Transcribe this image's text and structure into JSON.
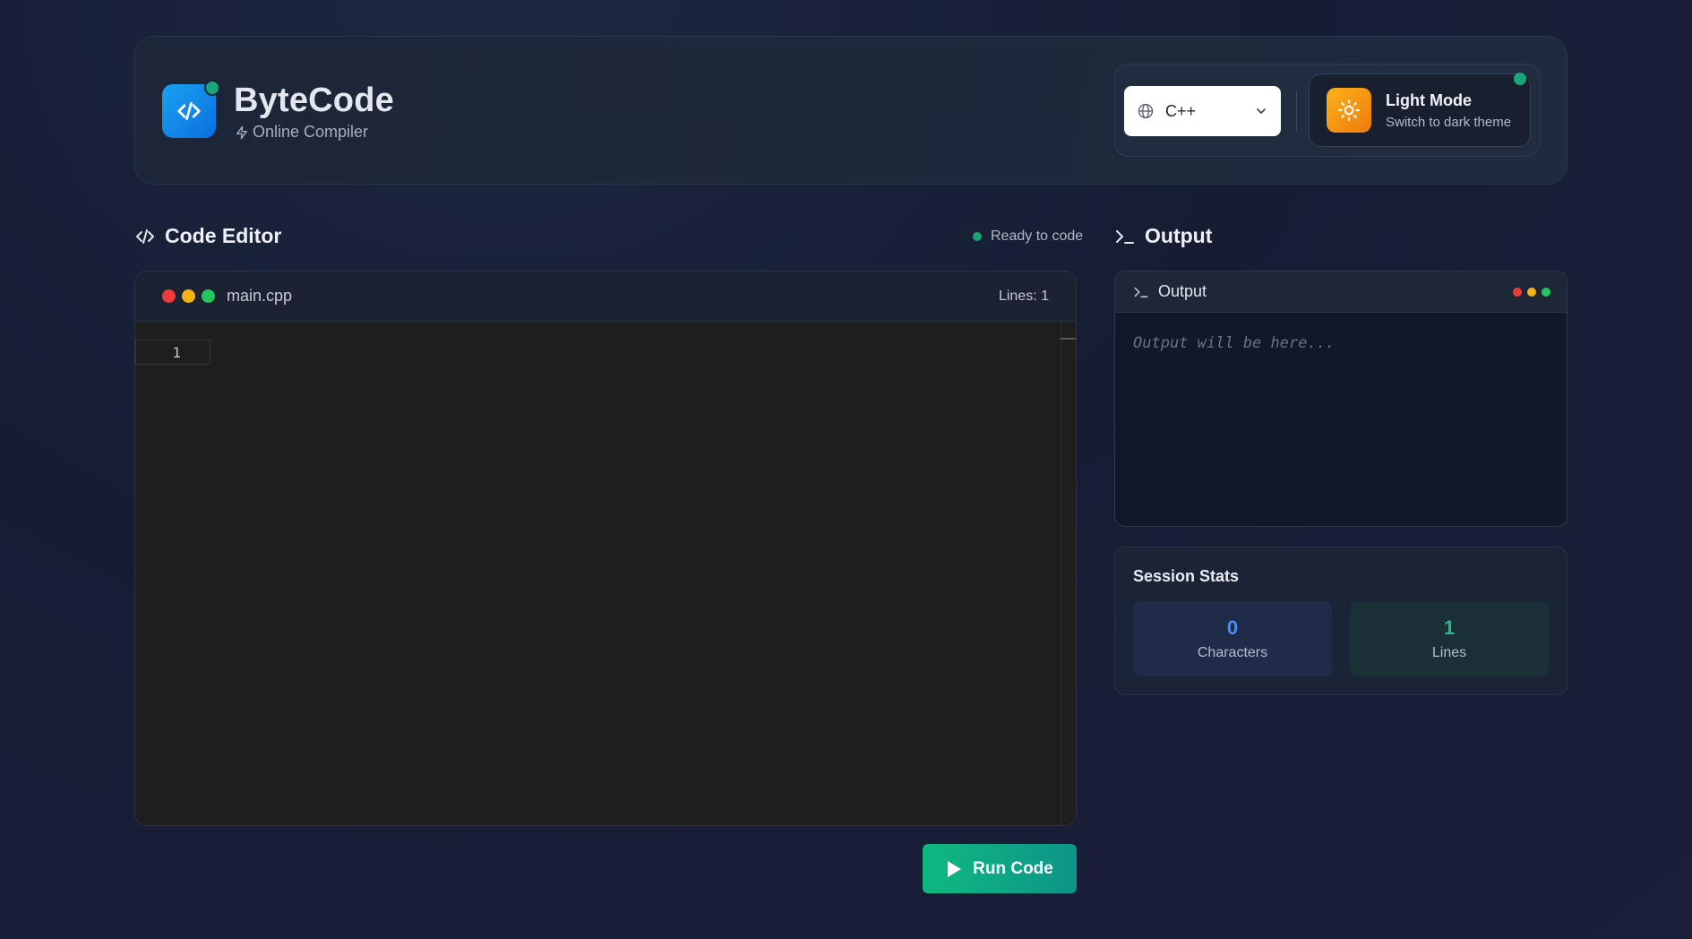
{
  "header": {
    "brand_title": "ByteCode",
    "brand_subtitle": "Online Compiler",
    "language": {
      "selected": "C++"
    },
    "theme_toggle": {
      "title": "Light Mode",
      "subtitle": "Switch to dark theme"
    }
  },
  "editor": {
    "section_title": "Code Editor",
    "status": "Ready to code",
    "filename": "main.cpp",
    "lines_label": "Lines: 1",
    "line_numbers": [
      "1"
    ]
  },
  "run_button": {
    "label": "Run Code"
  },
  "output": {
    "section_title": "Output",
    "panel_label": "Output",
    "placeholder": "Output will be here..."
  },
  "stats": {
    "title": "Session Stats",
    "characters": {
      "value": "0",
      "label": "Characters"
    },
    "lines": {
      "value": "1",
      "label": "Lines"
    }
  },
  "colors": {
    "accent_blue": "#0a6fe0",
    "accent_green": "#10b981",
    "accent_orange": "#f07a0c",
    "status_dot": "#16a672",
    "traffic_red": "#ef3b3b",
    "traffic_yellow": "#f3b317",
    "traffic_green": "#22c55e"
  },
  "icons": {
    "logo": "code-brackets-icon",
    "subtitle": "lightning-icon",
    "language": "globe-icon",
    "dropdown": "chevron-down-icon",
    "theme": "sun-icon",
    "editor_heading": "code-brackets-icon",
    "output_heading": "terminal-icon",
    "run": "play-icon"
  }
}
